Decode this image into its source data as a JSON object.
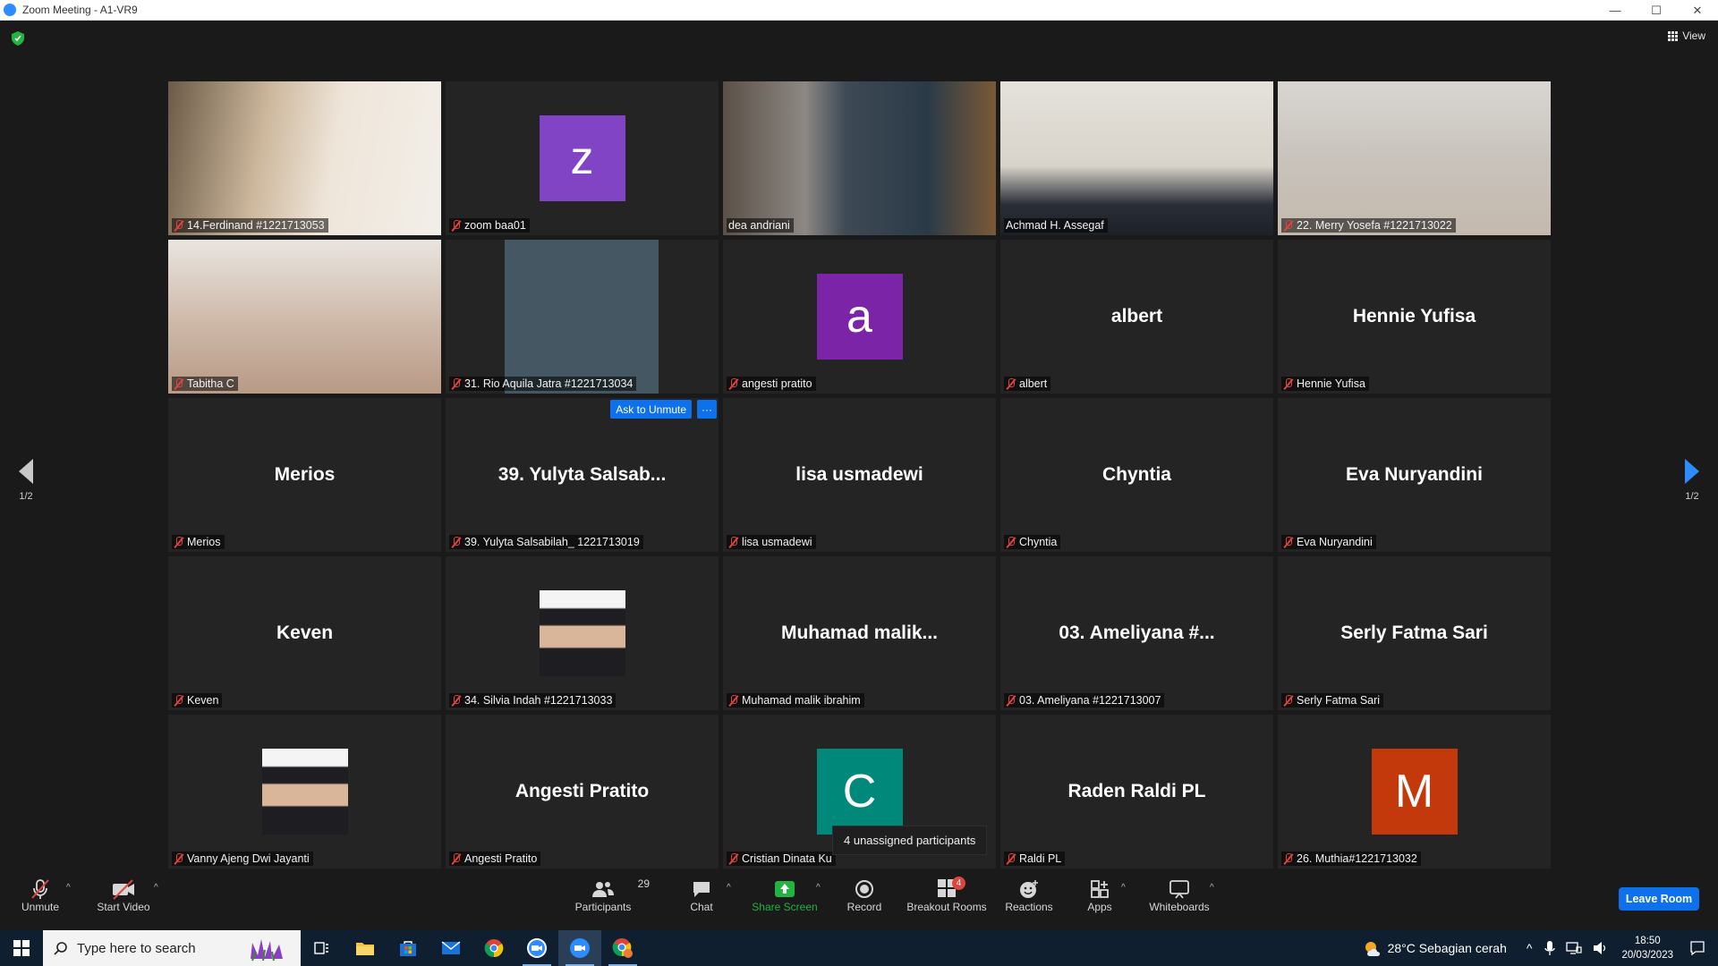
{
  "window": {
    "title": "Zoom Meeting - A1-VR9",
    "min": "—",
    "max": "☐",
    "close": "✕"
  },
  "meeting": {
    "view_label": "View",
    "page_left": "1/2",
    "page_right": "1/2",
    "ask_unmute": "Ask to Unmute",
    "more": "···",
    "tooltip": "4 unassigned participants"
  },
  "tiles": [
    {
      "label": "14.Ferdinand #1221713053",
      "type": "photo"
    },
    {
      "label": "zoom baa01",
      "type": "avatar",
      "letter": "z",
      "color": "#8144c4"
    },
    {
      "label": "dea andriani",
      "type": "photo",
      "speaking": true
    },
    {
      "label": "Achmad H. Assegaf",
      "type": "photo"
    },
    {
      "label": "22. Merry Yosefa #1221713022",
      "type": "photo"
    },
    {
      "label": "Tabitha C",
      "type": "photo"
    },
    {
      "label": "31. Rio Aquila Jatra #1221713034",
      "type": "blank"
    },
    {
      "label": "angesti pratito",
      "type": "avatar",
      "letter": "a",
      "color": "#7b24a8"
    },
    {
      "label": "albert",
      "name": "albert",
      "type": "name"
    },
    {
      "label": "Hennie Yufisa",
      "name": "Hennie Yufisa",
      "type": "name"
    },
    {
      "label": "Merios",
      "name": "Merios",
      "type": "name"
    },
    {
      "label": "39. Yulyta Salsabilah_ 1221713019",
      "name": "39. Yulyta Salsab...",
      "type": "name"
    },
    {
      "label": "lisa usmadewi",
      "name": "lisa usmadewi",
      "type": "name"
    },
    {
      "label": "Chyntia",
      "name": "Chyntia",
      "type": "name"
    },
    {
      "label": "Eva Nuryandini",
      "name": "Eva Nuryandini",
      "type": "name"
    },
    {
      "label": "Keven",
      "name": "Keven",
      "type": "name"
    },
    {
      "label": "34. Silvia Indah #1221713033",
      "type": "portrait"
    },
    {
      "label": "Muhamad malik ibrahim",
      "name": "Muhamad  malik...",
      "type": "name"
    },
    {
      "label": "03. Ameliyana #1221713007",
      "name": "03. Ameliyana #...",
      "type": "name"
    },
    {
      "label": "Serly Fatma Sari",
      "name": "Serly Fatma Sari",
      "type": "name"
    },
    {
      "label": "Vanny Ajeng Dwi Jayanti",
      "type": "portrait"
    },
    {
      "label": "Angesti Pratito",
      "name": "Angesti Pratito",
      "type": "name"
    },
    {
      "label": "Cristian Dinata Ku",
      "type": "avatar",
      "letter": "C",
      "color": "#00897b"
    },
    {
      "label": "Raldi PL",
      "name": "Raden Raldi PL",
      "type": "name"
    },
    {
      "label": "26. Muthia#1221713032",
      "type": "avatar",
      "letter": "M",
      "color": "#c4390c"
    }
  ],
  "toolbar": {
    "unmute": "Unmute",
    "start_video": "Start Video",
    "participants": "Participants",
    "participants_count": "29",
    "chat": "Chat",
    "share_screen": "Share Screen",
    "record": "Record",
    "breakout_rooms": "Breakout Rooms",
    "breakout_badge": "4",
    "reactions": "Reactions",
    "apps": "Apps",
    "whiteboards": "Whiteboards",
    "leave": "Leave Room"
  },
  "taskbar": {
    "search_placeholder": "Type here to search",
    "weather": "28°C  Sebagian cerah",
    "time": "18:50",
    "date": "20/03/2023"
  },
  "colors": {
    "accent": "#0e71eb",
    "share_green": "#23b340",
    "muted_red": "#e0443e",
    "speaker_outline": "#e9e96a"
  }
}
